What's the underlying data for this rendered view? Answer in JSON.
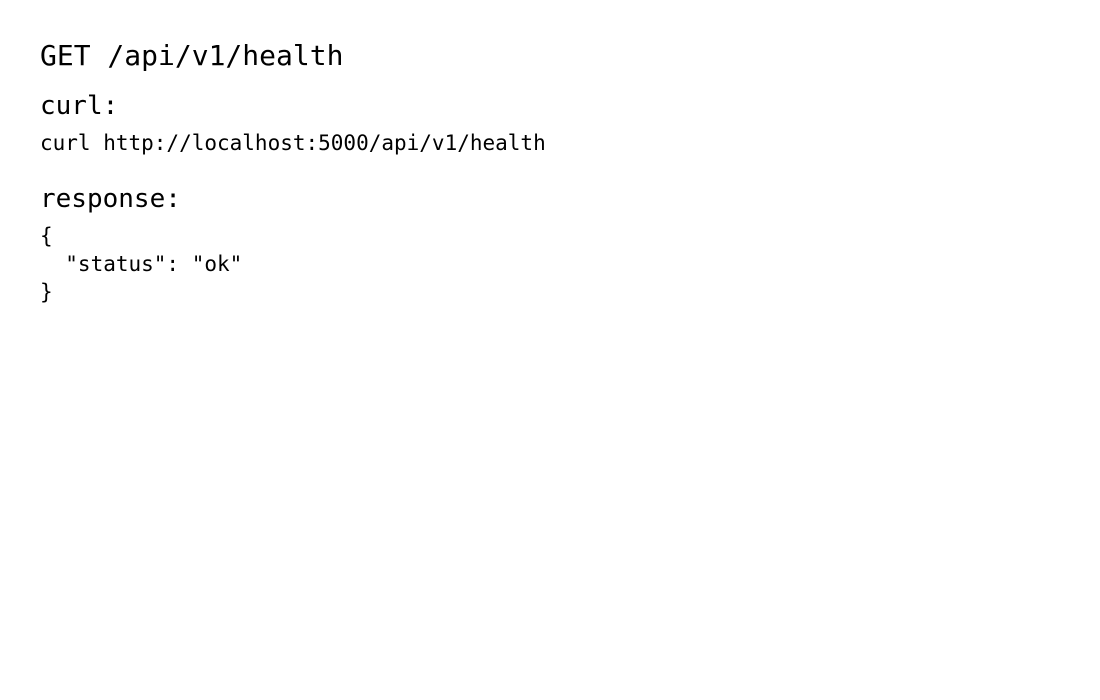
{
  "endpoint": {
    "title": "GET /api/v1/health"
  },
  "curl": {
    "heading": "curl:",
    "command": "curl http://localhost:5000/api/v1/health"
  },
  "response": {
    "heading": "response:",
    "body": "{\n  \"status\": \"ok\"\n}"
  }
}
